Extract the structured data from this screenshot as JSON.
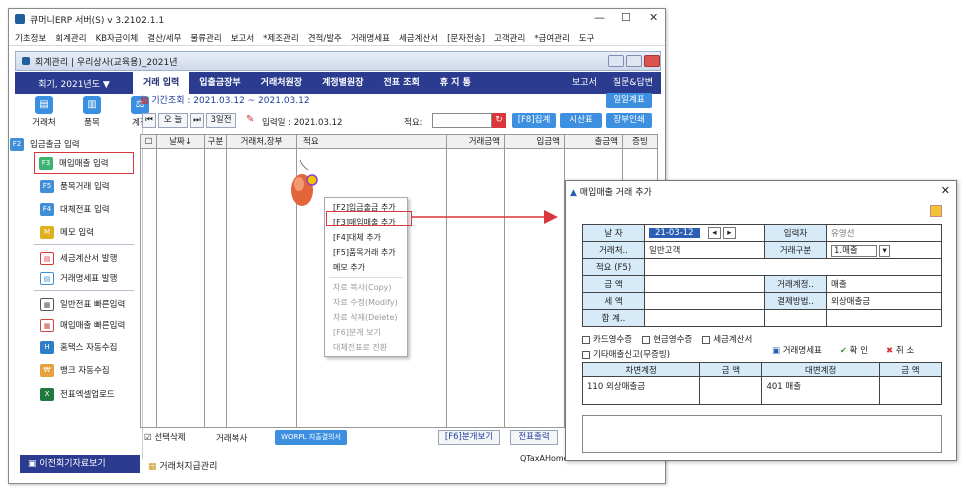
{
  "app": {
    "title": "큐머니ERP 서버(S)  v 3.2102.1.1",
    "menu": [
      "기초정보",
      "회계관리",
      "KB자금이체",
      "결산/세무",
      "물류관리",
      "보고서",
      "*제조관리",
      "견적/발주",
      "거래명세표",
      "세금계산서",
      "[문자전송]",
      "고객관리",
      "*급여관리",
      "도구"
    ]
  },
  "subwindow": {
    "title": "회계관리 | 우리상사(교육용)_2021년"
  },
  "navbar": {
    "year": "회기, 2021년도 ▼",
    "tabs": [
      "거래 입력",
      "입출금장부",
      "거래처원장",
      "계정별원장",
      "전표 조회",
      "휴 지 통"
    ],
    "right": [
      "보고서",
      "질문&답변"
    ]
  },
  "toolbar_icons": [
    "거래처",
    "품목",
    "계정"
  ],
  "left_menu": {
    "group1": [
      {
        "key": "F2",
        "label": "입금출금 입력",
        "color": "#3f8fd8"
      },
      {
        "key": "F3",
        "label": "매입매출 입력",
        "color": "#3cb371"
      },
      {
        "key": "F5",
        "label": "품목거래 입력",
        "color": "#3f8fd8"
      },
      {
        "key": "F4",
        "label": "대체전표 입력",
        "color": "#3f8fd8"
      },
      {
        "key": "M",
        "label": "메모 입력",
        "color": "#e0b020"
      }
    ],
    "group2": [
      "세금계산서 발행",
      "거래명세표 발행"
    ],
    "group3": [
      "일반전표 빠른입력",
      "매입매출 빠른입력",
      "홈택스 자동수집",
      "뱅크 자동수집",
      "전표엑셀업로드"
    ]
  },
  "date_filter": {
    "label": "기간조회 : 2021.03.12 ~ 2021.03.12",
    "today": "오 늘",
    "prev3": "3일전",
    "entry_date": "입력일 : 2021.03.12",
    "summary_label": "적요:",
    "buttons": [
      "[F8]집계",
      "시산표",
      "장부인쇄"
    ],
    "daily_report": "일일계표"
  },
  "grid": {
    "headers": [
      "☐",
      "날짜↓",
      "구분",
      "거래처,장부",
      "적요",
      "거래금액",
      "입금액",
      "출금액",
      "증빙"
    ]
  },
  "context_menu": {
    "items": [
      {
        "label": "[F2]입금출금 추가",
        "enabled": true
      },
      {
        "label": "[F3]매입매출 추가",
        "enabled": true
      },
      {
        "label": "[F4]대체 추가",
        "enabled": true
      },
      {
        "label": "[F5]품목거래 추가",
        "enabled": true
      },
      {
        "label": "메모 추가",
        "enabled": true
      },
      {
        "label": "자료 복사(Copy)",
        "enabled": false
      },
      {
        "label": "자료 수정(Modify)",
        "enabled": false
      },
      {
        "label": "자료 삭제(Delete)",
        "enabled": false
      },
      {
        "label": "[F6]분개 보기",
        "enabled": false
      },
      {
        "label": "대체전표로 전환",
        "enabled": false
      }
    ]
  },
  "bottom": {
    "select_delete": "선택삭제",
    "copy_trade": "거래복사",
    "worpl": "WORPL 지출결의서",
    "f6": "[F6]분개보기",
    "print": "전표출력"
  },
  "status": {
    "left": "이전회기자료보기",
    "mid": "거래처지급관리",
    "right": "QTaxAHome"
  },
  "dialog": {
    "title": "매입매출 거래 추가",
    "date_label": "날 자",
    "date_value": "21-03-12",
    "writer_label": "입력자",
    "writer_value": "유영선",
    "client_label": "거래처..",
    "client_value": "일반고객",
    "trade_type_label": "거래구분",
    "trade_type_value": "1.매출",
    "summary_label": "적요 (F5)",
    "amount_label": "금  액",
    "account_label": "거래계정..",
    "account_value": "매출",
    "tax_label": "세  액",
    "payment_label": "결제방법..",
    "payment_value": "외상매출금",
    "total_label": "합  계..",
    "checks": [
      "카드영수증",
      "현금영수증",
      "세금계산서",
      "기타매출신고(무증빙)"
    ],
    "actions": [
      "거래명세표",
      "확 인",
      "취 소"
    ],
    "lines_headers": [
      "차변계정",
      "금 액",
      "대변계정",
      "금 액"
    ],
    "lines": [
      {
        "debit": "110  외상매출금",
        "debit_amt": "",
        "credit": "401  매출",
        "credit_amt": ""
      }
    ]
  }
}
